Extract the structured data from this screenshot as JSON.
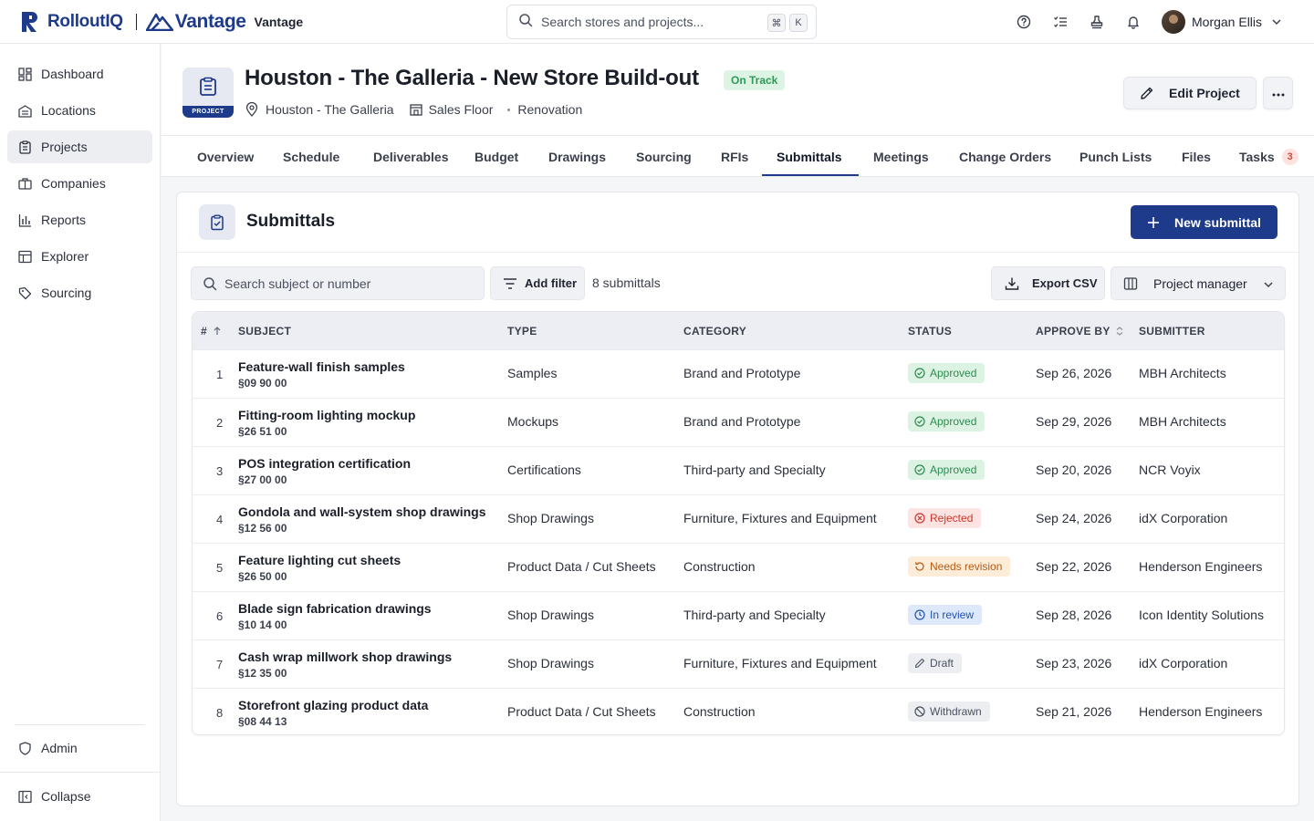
{
  "app": {
    "brand_name": "RolloutIQ",
    "client_name": "Vantage",
    "client_label": "Vantage",
    "search_placeholder": "Search stores and projects...",
    "shortcut_keys": [
      "⌘",
      "K"
    ],
    "user_name": "Morgan Ellis",
    "accent_color": "#1e3a8a"
  },
  "sidebar": {
    "items": [
      {
        "label": "Dashboard",
        "icon": "dashboard-icon"
      },
      {
        "label": "Locations",
        "icon": "building-icon"
      },
      {
        "label": "Projects",
        "icon": "clipboard-icon",
        "active": true
      },
      {
        "label": "Companies",
        "icon": "briefcase-icon"
      },
      {
        "label": "Reports",
        "icon": "bar-chart-icon"
      },
      {
        "label": "Explorer",
        "icon": "table-icon"
      },
      {
        "label": "Sourcing",
        "icon": "tag-icon"
      }
    ],
    "admin_label": "Admin",
    "collapse_label": "Collapse"
  },
  "project": {
    "badge": "PROJECT",
    "title": "Houston - The Galleria - New Store Build-out",
    "status": "On Track",
    "location": "Houston - The Galleria",
    "area": "Sales Floor",
    "type": "Renovation",
    "edit_label": "Edit Project"
  },
  "tabs": [
    {
      "label": "Overview"
    },
    {
      "label": "Schedule"
    },
    {
      "label": "Deliverables"
    },
    {
      "label": "Budget"
    },
    {
      "label": "Drawings"
    },
    {
      "label": "Sourcing"
    },
    {
      "label": "RFIs"
    },
    {
      "label": "Submittals",
      "active": true
    },
    {
      "label": "Meetings"
    },
    {
      "label": "Change Orders"
    },
    {
      "label": "Punch Lists"
    },
    {
      "label": "Files"
    },
    {
      "label": "Tasks",
      "badge": "3"
    }
  ],
  "submittals": {
    "title": "Submittals",
    "new_label": "New submittal",
    "search_placeholder": "Search subject or number",
    "filter_label": "Add filter",
    "count_text": "8 submittals",
    "export_label": "Export CSV",
    "view_label": "Project manager",
    "columns": {
      "num": "#",
      "subject": "SUBJECT",
      "type": "TYPE",
      "category": "CATEGORY",
      "status": "STATUS",
      "approve_by": "APPROVE BY",
      "submitter": "SUBMITTER"
    },
    "rows": [
      {
        "num": "1",
        "subject": "Feature-wall finish samples",
        "code": "§09 90 00",
        "type": "Samples",
        "category": "Brand and Prototype",
        "status": "Approved",
        "status_kind": "approved",
        "approve_by": "Sep 26, 2026",
        "submitter": "MBH Architects"
      },
      {
        "num": "2",
        "subject": "Fitting-room lighting mockup",
        "code": "§26 51 00",
        "type": "Mockups",
        "category": "Brand and Prototype",
        "status": "Approved",
        "status_kind": "approved",
        "approve_by": "Sep 29, 2026",
        "submitter": "MBH Architects"
      },
      {
        "num": "3",
        "subject": "POS integration certification",
        "code": "§27 00 00",
        "type": "Certifications",
        "category": "Third-party and Specialty",
        "status": "Approved",
        "status_kind": "approved",
        "approve_by": "Sep 20, 2026",
        "submitter": "NCR Voyix"
      },
      {
        "num": "4",
        "subject": "Gondola and wall-system shop drawings",
        "code": "§12 56 00",
        "type": "Shop Drawings",
        "category": "Furniture, Fixtures and Equipment",
        "status": "Rejected",
        "status_kind": "rejected",
        "approve_by": "Sep 24, 2026",
        "submitter": "idX Corporation"
      },
      {
        "num": "5",
        "subject": "Feature lighting cut sheets",
        "code": "§26 50 00",
        "type": "Product Data / Cut Sheets",
        "category": "Construction",
        "status": "Needs revision",
        "status_kind": "revision",
        "approve_by": "Sep 22, 2026",
        "submitter": "Henderson Engineers"
      },
      {
        "num": "6",
        "subject": "Blade sign fabrication drawings",
        "code": "§10 14 00",
        "type": "Shop Drawings",
        "category": "Third-party and Specialty",
        "status": "In review",
        "status_kind": "review",
        "approve_by": "Sep 28, 2026",
        "submitter": "Icon Identity Solutions"
      },
      {
        "num": "7",
        "subject": "Cash wrap millwork shop drawings",
        "code": "§12 35 00",
        "type": "Shop Drawings",
        "category": "Furniture, Fixtures and Equipment",
        "status": "Draft",
        "status_kind": "draft",
        "approve_by": "Sep 23, 2026",
        "submitter": "idX Corporation"
      },
      {
        "num": "8",
        "subject": "Storefront glazing product data",
        "code": "§08 44 13",
        "type": "Product Data / Cut Sheets",
        "category": "Construction",
        "status": "Withdrawn",
        "status_kind": "withdrawn",
        "approve_by": "Sep 21, 2026",
        "submitter": "Henderson Engineers"
      }
    ]
  },
  "status_colors": {
    "approved": {
      "bg": "#dcf3e3",
      "fg": "#2d8a4f"
    },
    "rejected": {
      "bg": "#fde3e1",
      "fg": "#c8382a"
    },
    "revision": {
      "bg": "#fdecd8",
      "fg": "#b65a12"
    },
    "review": {
      "bg": "#dde8fb",
      "fg": "#2152b8"
    },
    "draft": {
      "bg": "#eceef1",
      "fg": "#4b5160"
    },
    "withdrawn": {
      "bg": "#eceef1",
      "fg": "#4b5160"
    }
  }
}
